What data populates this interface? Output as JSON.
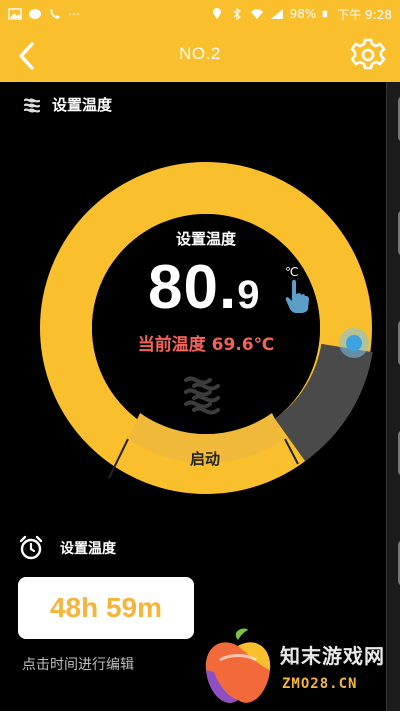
{
  "status_bar": {
    "battery": "98%",
    "time": "下午 9:28",
    "left_icons": [
      "gallery-icon",
      "chat-icon",
      "phone-icon",
      "more-icon"
    ],
    "right_icons": [
      "location-icon",
      "bluetooth-icon",
      "wifi-icon",
      "signal-icon",
      "battery-icon"
    ]
  },
  "header": {
    "title": "NO.2",
    "color": "#f9bf2c"
  },
  "setting_section": {
    "label": "设置温度"
  },
  "dial": {
    "set_label": "设置温度",
    "value_int": "80.",
    "value_dec": "9",
    "unit": "℃",
    "current_temp": "当前温度 69.6℃",
    "start_label": "启动",
    "colors": {
      "ring": "#f9bf2c",
      "inactive": "#4a4a4a",
      "knob": "#3aa3e0",
      "current": "#f2645a"
    }
  },
  "timer": {
    "label": "设置温度",
    "value": "48h 59m",
    "hint": "点击时间进行编辑"
  },
  "watermark": {
    "name": "知末游戏网",
    "url": "ZMO28.CN"
  }
}
